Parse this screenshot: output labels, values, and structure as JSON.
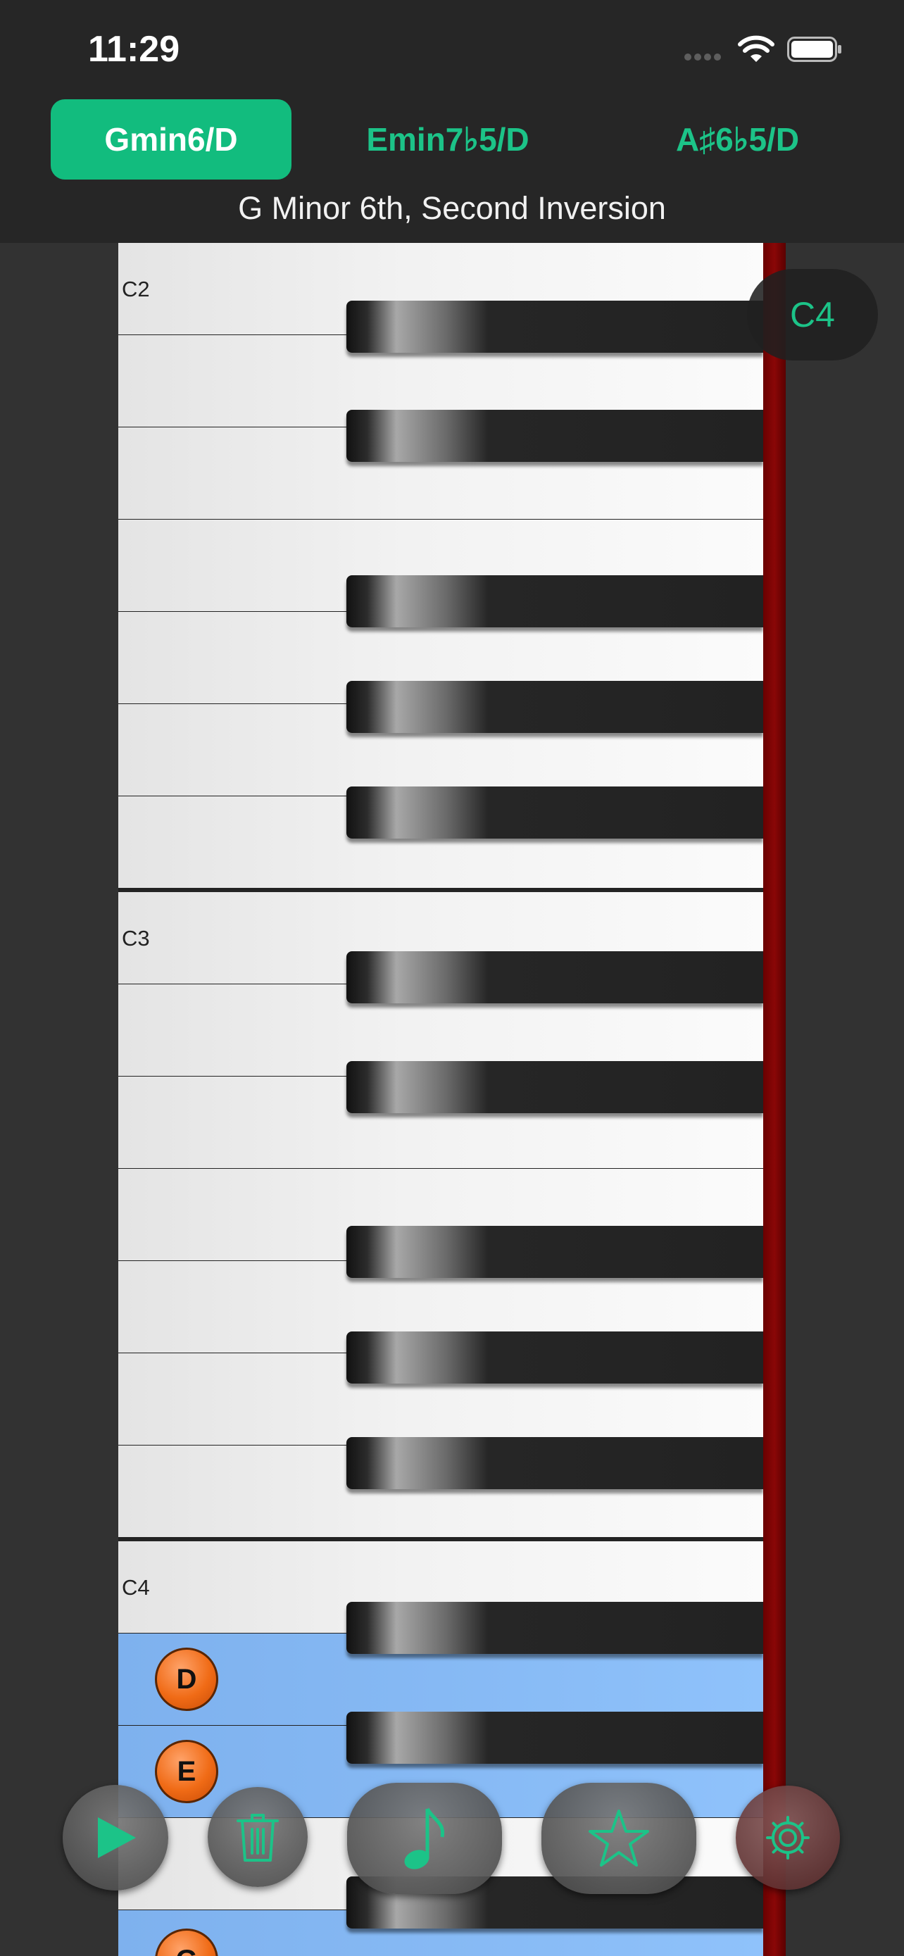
{
  "status_bar": {
    "time": "11:29"
  },
  "chord_tabs": [
    {
      "label": "Gmin6/D",
      "active": true
    },
    {
      "label": "Emin7♭5/D",
      "active": false
    },
    {
      "label": "A♯6♭5/D",
      "active": false
    }
  ],
  "chord_name": "G Minor 6th, Second Inversion",
  "octave_indicator": "C4",
  "keyboard": {
    "octave_labels": [
      "C2",
      "C3",
      "C4"
    ],
    "highlighted_notes": [
      "D",
      "E",
      "G"
    ]
  },
  "toolbar": [
    {
      "icon": "play-icon"
    },
    {
      "icon": "trash-icon"
    },
    {
      "icon": "music-note-icon"
    },
    {
      "icon": "star-icon"
    },
    {
      "icon": "gear-icon"
    }
  ],
  "colors": {
    "accent": "#1cc388",
    "highlight": "#86b9f4",
    "note_badge": "#f06b16",
    "rail": "#7a0303"
  }
}
